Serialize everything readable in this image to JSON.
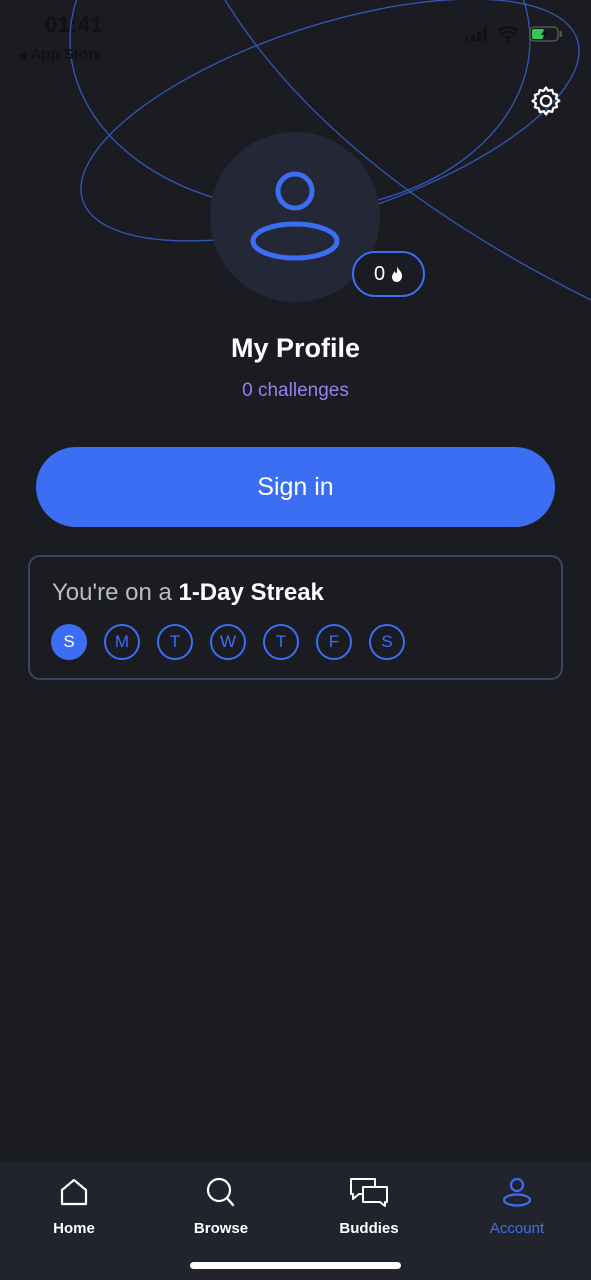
{
  "status_bar": {
    "time": "01:41",
    "back_label": "App Store",
    "icons": [
      "signal-icon",
      "wifi-icon",
      "battery-icon"
    ]
  },
  "header": {
    "settings_icon": "gear-icon"
  },
  "profile": {
    "title": "My Profile",
    "challenges": "0 challenges",
    "streak_count": "0",
    "avatar_icon": "user-icon",
    "flame_icon": "flame-icon"
  },
  "actions": {
    "sign_in_label": "Sign in"
  },
  "streak": {
    "prefix": "You're on a ",
    "highlight": "1-Day Streak",
    "days": [
      "S",
      "M",
      "T",
      "W",
      "T",
      "F",
      "S"
    ],
    "active_days": [
      0
    ]
  },
  "tabs": [
    {
      "label": "Home",
      "icon": "home-icon",
      "active": false
    },
    {
      "label": "Browse",
      "icon": "search-icon",
      "active": false
    },
    {
      "label": "Buddies",
      "icon": "chat-bubbles-icon",
      "active": false
    },
    {
      "label": "Account",
      "icon": "account-icon",
      "active": true
    }
  ],
  "colors": {
    "background": "#1b1c22",
    "accent": "#3b6ef3",
    "challenges_text": "#9b7ff0",
    "tabbar": "#22242d"
  }
}
